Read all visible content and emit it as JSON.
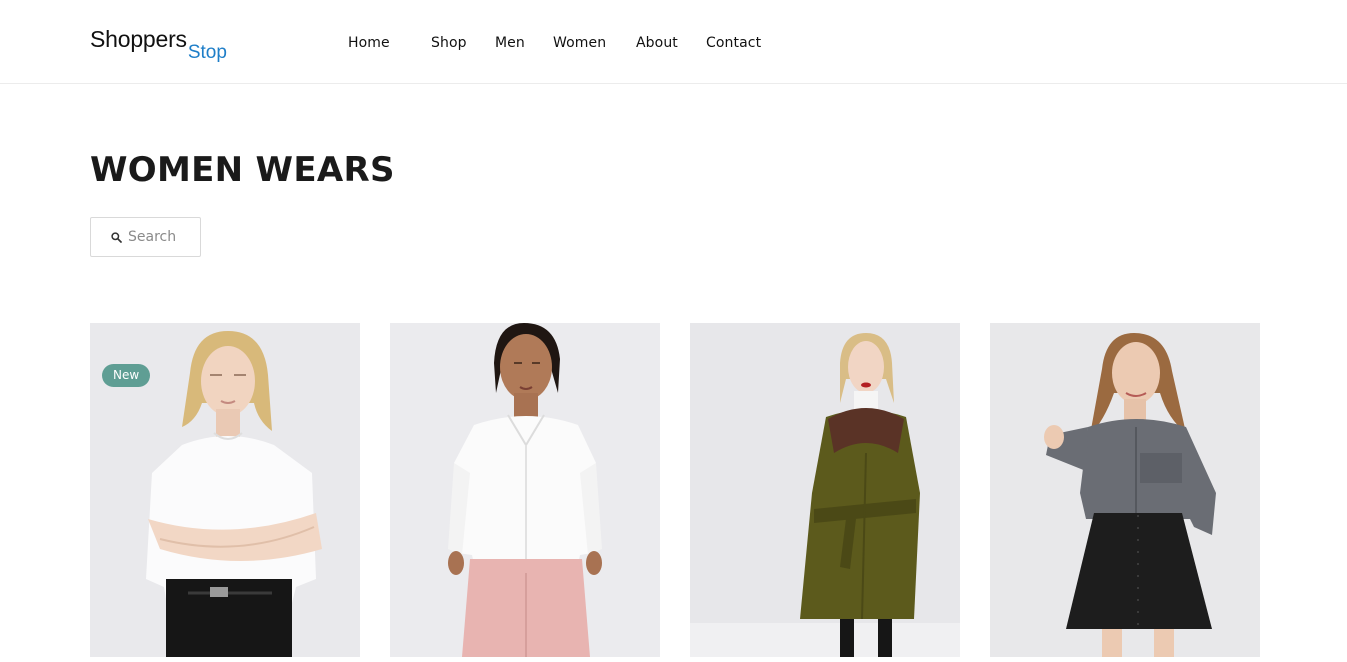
{
  "logo": {
    "main": "Shoppers",
    "sub": "Stop"
  },
  "nav": {
    "items": [
      {
        "label": "Home"
      },
      {
        "label": "Shop"
      },
      {
        "label": "Men"
      },
      {
        "label": "Women"
      },
      {
        "label": "About"
      },
      {
        "label": "Contact"
      }
    ]
  },
  "page": {
    "title": "WOMEN WEARS"
  },
  "search": {
    "placeholder": "Search",
    "icon": "search-icon"
  },
  "products": [
    {
      "badge": "New",
      "image": "woman-white-tshirt-black-jeans"
    },
    {
      "image": "woman-white-shirt-pink-trousers"
    },
    {
      "image": "woman-olive-coat-fur-collar"
    },
    {
      "image": "woman-grey-shirt-black-skirt"
    }
  ],
  "colors": {
    "accent": "#1e7ec8",
    "badge": "#5f9e94",
    "text": "#1a1a1a",
    "border": "#d9d9d9"
  }
}
